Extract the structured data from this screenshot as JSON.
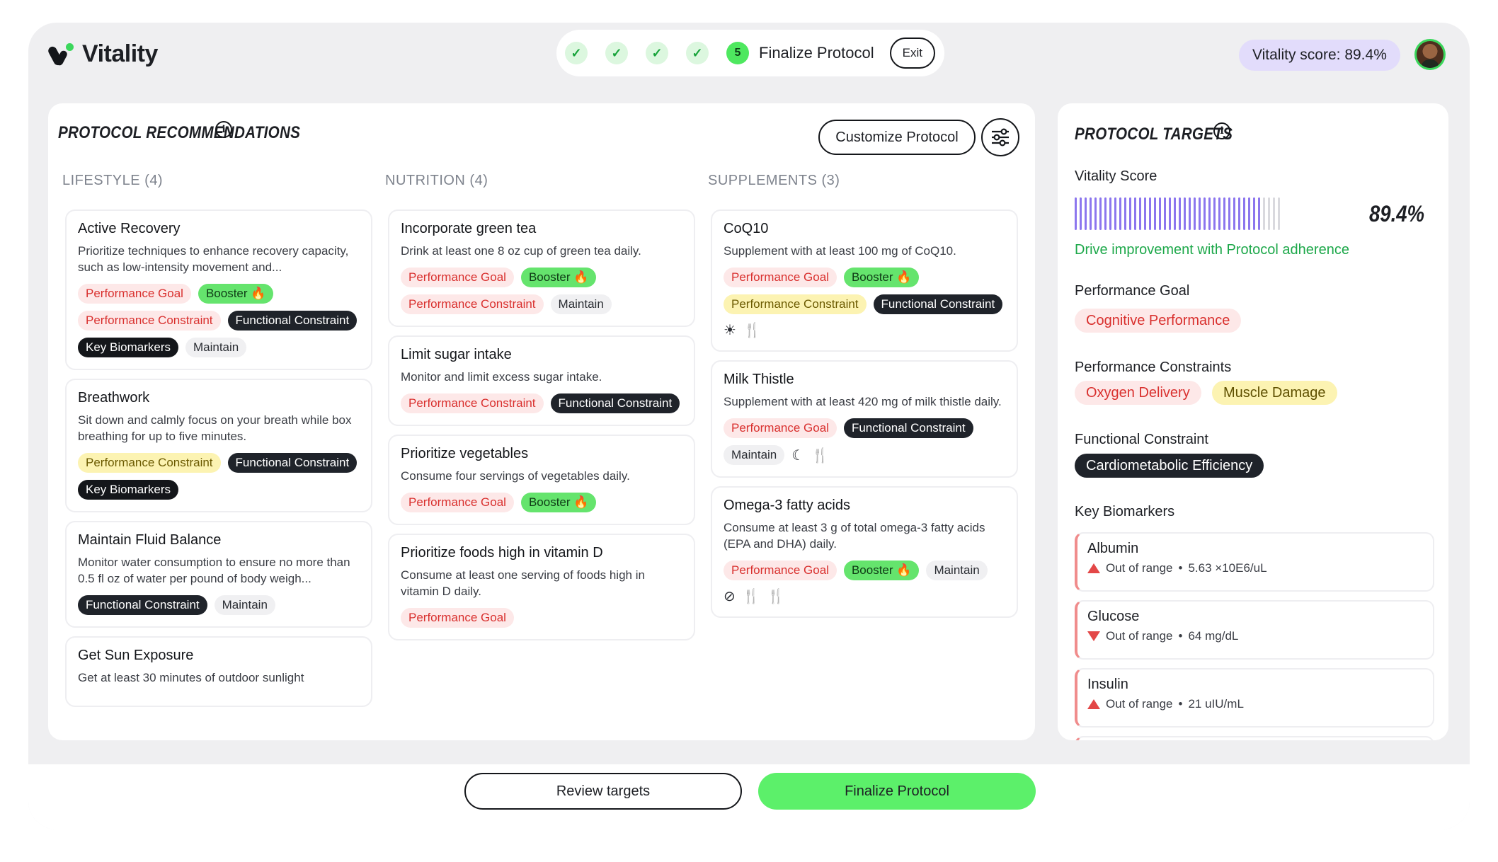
{
  "brand": {
    "name": "Vitality"
  },
  "stepper": {
    "completed_steps": [
      "✓",
      "✓",
      "✓",
      "✓"
    ],
    "current_step_number": "5",
    "current_step_label": "Finalize Protocol",
    "exit_label": "Exit"
  },
  "header": {
    "score_label": "Vitality score: 89.4%"
  },
  "recommendations": {
    "title": "PROTOCOL RECOMMENDATIONS",
    "customize_label": "Customize Protocol",
    "columns": [
      {
        "heading": "LIFESTYLE (4)",
        "cards": [
          {
            "title": "Active Recovery",
            "desc": "Prioritize techniques to enhance recovery capacity, such as low-intensity movement and...",
            "tags": [
              {
                "text": "Performance Goal",
                "kind": "goal"
              },
              {
                "text": "Booster 🔥",
                "kind": "booster"
              },
              {
                "text": "Performance Constraint",
                "kind": "constraint-red"
              },
              {
                "text": "Functional Constraint",
                "kind": "functional"
              },
              {
                "text": "Key Biomarkers",
                "kind": "biomarkers"
              },
              {
                "text": "Maintain",
                "kind": "maintain"
              }
            ]
          },
          {
            "title": "Breathwork",
            "desc": "Sit down and calmly focus on your breath while box breathing for up to five minutes.",
            "tags": [
              {
                "text": "Performance Constraint",
                "kind": "constraint-yellow"
              },
              {
                "text": "Functional Constraint",
                "kind": "functional"
              },
              {
                "text": "Key Biomarkers",
                "kind": "biomarkers"
              }
            ]
          },
          {
            "title": "Maintain Fluid Balance",
            "desc": "Monitor water consumption to ensure no more than 0.5 fl oz of water per pound of body weigh...",
            "tags": [
              {
                "text": "Functional Constraint",
                "kind": "functional"
              },
              {
                "text": "Maintain",
                "kind": "maintain"
              }
            ]
          },
          {
            "title": "Get Sun Exposure",
            "desc": "Get at least 30 minutes of outdoor sunlight",
            "tags": []
          }
        ]
      },
      {
        "heading": "NUTRITION (4)",
        "cards": [
          {
            "title": "Incorporate green tea",
            "desc": "Drink at least one 8 oz cup of green tea daily.",
            "tags": [
              {
                "text": "Performance Goal",
                "kind": "goal"
              },
              {
                "text": "Booster 🔥",
                "kind": "booster"
              },
              {
                "text": "Performance Constraint",
                "kind": "constraint-red"
              },
              {
                "text": "Maintain",
                "kind": "maintain"
              }
            ]
          },
          {
            "title": "Limit sugar intake",
            "desc": "Monitor and limit excess sugar intake.",
            "tags": [
              {
                "text": "Performance Constraint",
                "kind": "constraint-red"
              },
              {
                "text": "Functional Constraint",
                "kind": "functional"
              }
            ]
          },
          {
            "title": "Prioritize vegetables",
            "desc": "Consume four servings of vegetables daily.",
            "tags": [
              {
                "text": "Performance Goal",
                "kind": "goal"
              },
              {
                "text": "Booster 🔥",
                "kind": "booster"
              }
            ]
          },
          {
            "title": "Prioritize foods high in vitamin D",
            "desc": "Consume at least one serving of foods high in vitamin D daily.",
            "tags": [
              {
                "text": "Performance Goal",
                "kind": "goal"
              }
            ]
          }
        ]
      },
      {
        "heading": "SUPPLEMENTS (3)",
        "cards": [
          {
            "title": "CoQ10",
            "desc": "Supplement with at least 100 mg of CoQ10.",
            "tags": [
              {
                "text": "Performance Goal",
                "kind": "goal"
              },
              {
                "text": "Booster 🔥",
                "kind": "booster"
              },
              {
                "text": "Performance Constraint",
                "kind": "constraint-yellow"
              },
              {
                "text": "Functional Constraint",
                "kind": "functional"
              },
              {
                "text": "☀",
                "kind": "glyph",
                "icon": "sun-icon"
              },
              {
                "text": "🍴",
                "kind": "glyph",
                "icon": "utensils-icon"
              }
            ]
          },
          {
            "title": "Milk Thistle",
            "desc": "Supplement with at least 420 mg of milk thistle daily.",
            "tags": [
              {
                "text": "Performance Goal",
                "kind": "goal"
              },
              {
                "text": "Functional Constraint",
                "kind": "functional"
              },
              {
                "text": "Maintain",
                "kind": "maintain"
              },
              {
                "text": "☾",
                "kind": "glyph",
                "icon": "moon-icon"
              },
              {
                "text": "🍴",
                "kind": "glyph",
                "icon": "no-food-icon"
              }
            ]
          },
          {
            "title": "Omega-3 fatty acids",
            "desc": "Consume at least 3 g of total omega-3 fatty acids (EPA and DHA) daily.",
            "tags": [
              {
                "text": "Performance Goal",
                "kind": "goal"
              },
              {
                "text": "Booster 🔥",
                "kind": "booster"
              },
              {
                "text": "Maintain",
                "kind": "maintain"
              },
              {
                "text": "⊘",
                "kind": "glyph",
                "icon": "fasting-icon"
              },
              {
                "text": "🍴",
                "kind": "glyph",
                "icon": "utensils-icon"
              },
              {
                "text": "🍴",
                "kind": "glyph",
                "icon": "no-food-icon"
              }
            ]
          }
        ]
      }
    ]
  },
  "targets": {
    "title": "PROTOCOL TARGETS",
    "vitality_label": "Vitality Score",
    "vitality_value": "89.4%",
    "vitality_fraction": 0.894,
    "drive_text": "Drive improvement with Protocol adherence",
    "goal_label": "Performance Goal",
    "goal_chip": "Cognitive Performance",
    "constraints_label": "Performance Constraints",
    "constraint_chips": [
      "Oxygen Delivery",
      "Muscle Damage"
    ],
    "functional_label": "Functional Constraint",
    "functional_chip": "Cardiometabolic Efficiency",
    "biomarkers_label": "Key Biomarkers",
    "biomarkers": [
      {
        "name": "Albumin",
        "status": "Out of range",
        "value": "5.63 ×10E6/uL",
        "direction": "up"
      },
      {
        "name": "Glucose",
        "status": "Out of range",
        "value": "64 mg/dL",
        "direction": "down"
      },
      {
        "name": "Insulin",
        "status": "Out of range",
        "value": "21 uIU/mL",
        "direction": "up"
      }
    ]
  },
  "footer": {
    "review_label": "Review targets",
    "finalize_label": "Finalize Protocol"
  },
  "colors": {
    "accent_green": "#5cf06a",
    "score_purple": "#e2dcfb",
    "bar_active": "#8c76ee",
    "bar_inactive": "#d9d9de",
    "alert_red": "#e34747"
  }
}
